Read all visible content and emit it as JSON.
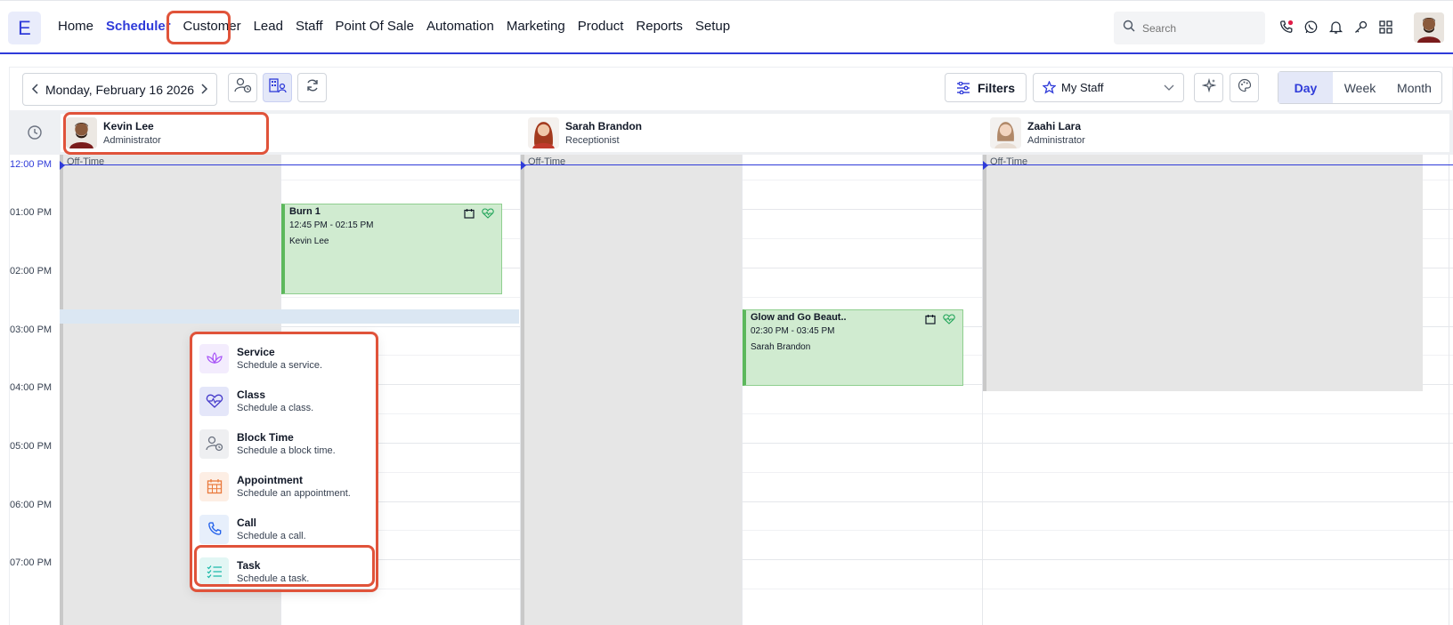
{
  "logo": {
    "letter": "E"
  },
  "nav": [
    {
      "label": "Home",
      "active": false
    },
    {
      "label": "Scheduler",
      "active": true
    },
    {
      "label": "Customer",
      "active": false
    },
    {
      "label": "Lead",
      "active": false
    },
    {
      "label": "Staff",
      "active": false
    },
    {
      "label": "Point Of Sale",
      "active": false
    },
    {
      "label": "Automation",
      "active": false
    },
    {
      "label": "Marketing",
      "active": false
    },
    {
      "label": "Product",
      "active": false
    },
    {
      "label": "Reports",
      "active": false
    },
    {
      "label": "Setup",
      "active": false
    }
  ],
  "search": {
    "placeholder": "Search"
  },
  "top_icons": [
    "phone-icon",
    "whatsapp-icon",
    "bell-icon",
    "key-icon",
    "apps-grid-icon"
  ],
  "toolbar": {
    "date": "Monday, February 16 2026",
    "filters_label": "Filters",
    "staff_select": "My Staff",
    "views": [
      "Day",
      "Week",
      "Month"
    ],
    "active_view": "Day"
  },
  "staff": [
    {
      "name": "Kevin Lee",
      "role": "Administrator"
    },
    {
      "name": "Sarah Brandon",
      "role": "Receptionist"
    },
    {
      "name": "Zaahi Lara",
      "role": "Administrator"
    }
  ],
  "times": [
    "12:00 PM",
    "01:00 PM",
    "02:00 PM",
    "03:00 PM",
    "04:00 PM",
    "05:00 PM",
    "06:00 PM",
    "07:00 PM"
  ],
  "off_time_label": "Off-Time",
  "events": [
    {
      "title": "Burn 1",
      "time": "12:45 PM - 02:15 PM",
      "staff": "Kevin Lee"
    },
    {
      "title": "Glow and Go Beaut..",
      "time": "02:30 PM - 03:45 PM",
      "staff": "Sarah Brandon"
    }
  ],
  "context_menu": [
    {
      "title": "Service",
      "desc": "Schedule a service.",
      "icon": "lotus-icon",
      "color": "#a855f7",
      "bg": "#f3ecfd"
    },
    {
      "title": "Class",
      "desc": "Schedule a class.",
      "icon": "heartbeat-icon",
      "color": "#4338ca",
      "bg": "#e4e6f9"
    },
    {
      "title": "Block Time",
      "desc": "Schedule a block time.",
      "icon": "user-clock-icon",
      "color": "#6b7280",
      "bg": "#eeeff1"
    },
    {
      "title": "Appointment",
      "desc": "Schedule an appointment.",
      "icon": "calendar-icon",
      "color": "#ea7a3c",
      "bg": "#fdeee4"
    },
    {
      "title": "Call",
      "desc": "Schedule a call.",
      "icon": "phone-icon",
      "color": "#2563eb",
      "bg": "#e7effb"
    },
    {
      "title": "Task",
      "desc": "Schedule a task.",
      "icon": "checklist-icon",
      "color": "#14b8a6",
      "bg": "#e2f6f4"
    }
  ],
  "colors": {
    "accent": "#2f3bd9",
    "highlight": "#e0533a",
    "event_bg": "#d0ebd0",
    "event_border": "#5cb85c",
    "off_time": "#e6e6e6"
  }
}
